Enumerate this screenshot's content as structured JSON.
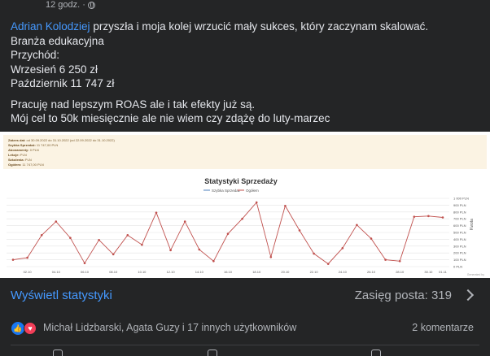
{
  "post": {
    "timestamp": "12 godz. ·",
    "mention": "Adrian Kolodziej",
    "lines": {
      "intro": " przyszła i moja kolej wrzucić mały sukces, który zaczynam skalować.",
      "industry": "Branża edukacyjna",
      "revenue_label": "Przychód:",
      "sep": "Wrzesień 6 250 zł",
      "oct": "Październik 11 747 zł",
      "roas": "Pracuję nad lepszym ROAS ale i tak efekty już są.",
      "goal": "Mój cel to 50k miesięcznie ale nie wiem czy zdążę do luty-marzec"
    }
  },
  "image": {
    "header": {
      "l1_label": "Zakres dat:",
      "l1_value": "od 30.09.2022 do 31.10.2022 (od 22.09.2022 do 31.10.2022)",
      "l2_label": "Szybka Sprzedaż:",
      "l2_value": "11 747,00 PLN",
      "l3_label": "Abonamenty:",
      "l3_value": "0 PLN",
      "l4_label": "Lekcje:",
      "l4_value": "PLN",
      "l5_label": "Szkolenia:",
      "l5_value": "PLN",
      "l6_label": "Ogółem:",
      "l6_value": "11 747,00 PLN"
    },
    "chart_data": {
      "type": "line",
      "title": "Statystyki Sprzedaży",
      "legend": [
        "Szybka Sprzedaż",
        "Ogółem"
      ],
      "ylabel": "Kwota",
      "ylim": [
        0,
        1000
      ],
      "yticks": [
        "0 PLN",
        "100 PLN",
        "200 PLN",
        "300 PLN",
        "400 PLN",
        "500 PLN",
        "600 PLN",
        "700 PLN",
        "800 PLN",
        "900 PLN",
        "1 000 PLN"
      ],
      "xticks": [
        "02.10",
        "04.10",
        "06.10",
        "08.10",
        "10.10",
        "12.10",
        "14.10",
        "16.10",
        "18.10",
        "20.10",
        "22.10",
        "24.10",
        "26.10",
        "28.10",
        "30.10",
        "01.11"
      ],
      "x": [
        "01.10",
        "02.10",
        "03.10",
        "04.10",
        "05.10",
        "06.10",
        "07.10",
        "08.10",
        "09.10",
        "10.10",
        "11.10",
        "12.10",
        "13.10",
        "14.10",
        "15.10",
        "16.10",
        "17.10",
        "18.10",
        "19.10",
        "20.10",
        "21.10",
        "22.10",
        "23.10",
        "24.10",
        "25.10",
        "26.10",
        "27.10",
        "28.10",
        "29.10",
        "30.10",
        "31.10"
      ],
      "series": [
        {
          "name": "Ogółem",
          "color": "#c0504d",
          "values": [
            100,
            130,
            460,
            660,
            420,
            50,
            390,
            180,
            460,
            320,
            790,
            240,
            660,
            250,
            80,
            480,
            700,
            940,
            140,
            890,
            530,
            190,
            40,
            270,
            610,
            410,
            100,
            80,
            730,
            740,
            720
          ]
        }
      ],
      "footer": "Generated by"
    }
  },
  "footer": {
    "view_stats": "Wyświetl statystyki",
    "reach": "Zasięg posta: 319",
    "reactors": "Michał Lidzbarski, Agata Guzy i 17 innych użytkowników",
    "comments": "2 komentarze",
    "like_glyph": "👍",
    "love_glyph": "♥"
  }
}
